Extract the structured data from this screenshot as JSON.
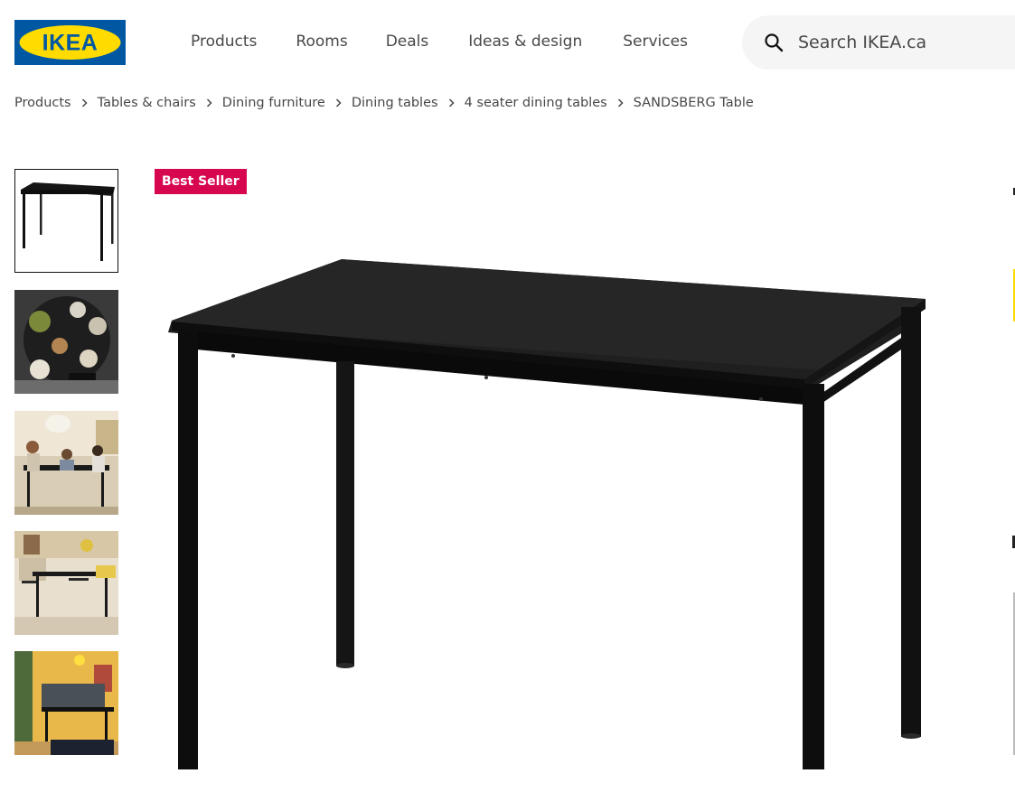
{
  "header": {
    "logo_text": "IKEA",
    "nav": [
      "Products",
      "Rooms",
      "Deals",
      "Ideas & design",
      "Services"
    ],
    "search": {
      "placeholder": "Search IKEA.ca",
      "icon": "search-icon"
    }
  },
  "breadcrumb": {
    "items": [
      "Products",
      "Tables & chairs",
      "Dining furniture",
      "Dining tables",
      "4 seater dining tables"
    ],
    "current": "SANDSBERG Table"
  },
  "product": {
    "badge": "Best Seller",
    "thumbnails": [
      "table-product-photo",
      "dining-overhead-photo",
      "family-dining-photo",
      "living-dining-room-photo",
      "yellow-wall-dining-photo"
    ],
    "selected_thumbnail": 0,
    "main_image": "black-table-photo"
  },
  "colors": {
    "brand_blue": "#0058a3",
    "brand_yellow": "#ffdb00",
    "badge_red": "#d6064f"
  }
}
